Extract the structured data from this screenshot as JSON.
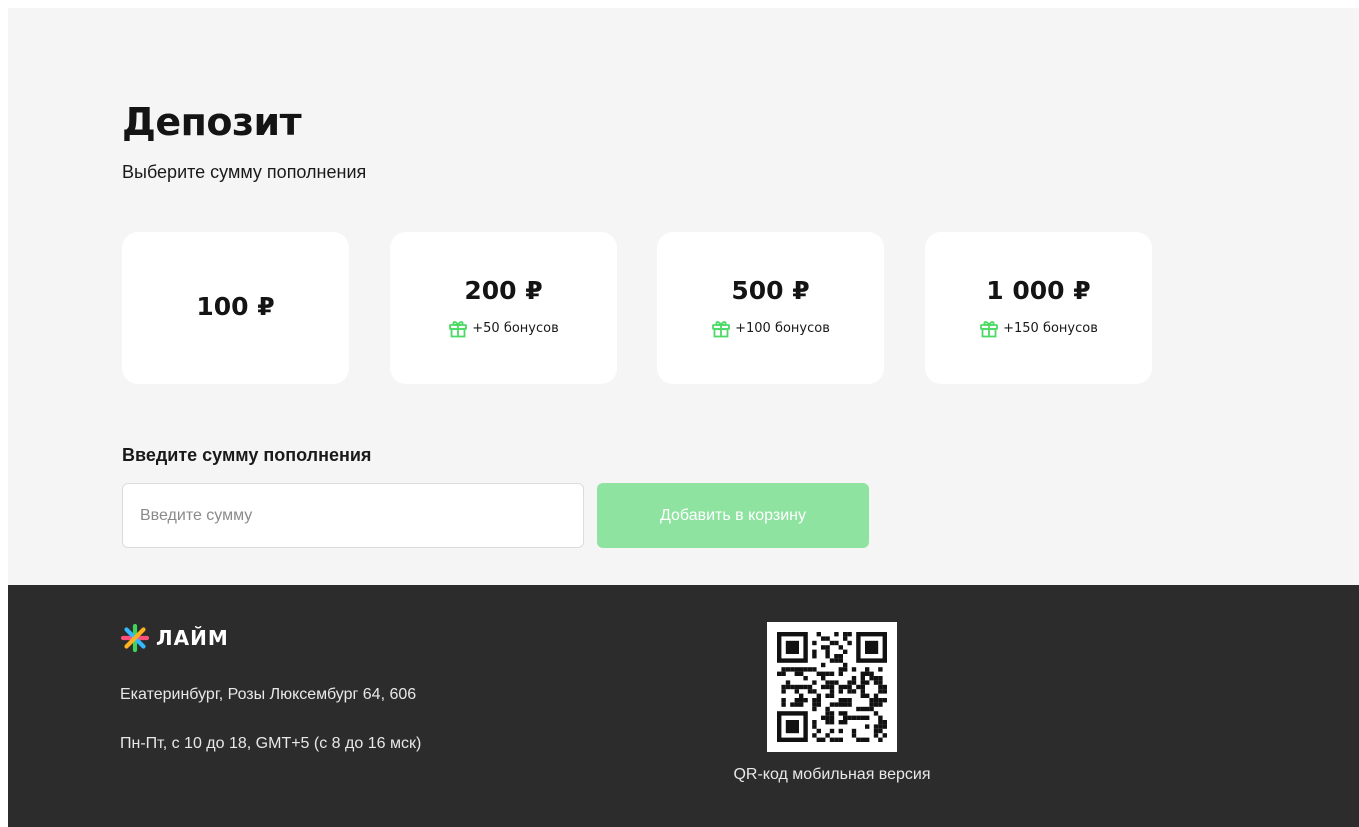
{
  "deposit": {
    "title": "Депозит",
    "subtitle": "Выберите сумму пополнения",
    "options": [
      {
        "price": "100 ₽"
      },
      {
        "price": "200 ₽",
        "bonus": "+50  бонусов"
      },
      {
        "price": "500 ₽",
        "bonus": "+100  бонусов"
      },
      {
        "price": "1 000 ₽",
        "bonus": "+150  бонусов"
      }
    ],
    "custom": {
      "label": "Введите сумму пополнения",
      "placeholder": "Введите сумму",
      "value": "",
      "button_label": "Добавить в корзину"
    },
    "colors": {
      "accent_green": "#8fe3a0",
      "gift_icon": "#4cd964"
    },
    "icons": {
      "bonus": "gift-icon"
    }
  },
  "footer": {
    "logo_text": "ЛАЙМ",
    "address": "Екатеринбург, Розы Люксембург 64, 606",
    "hours": "Пн-Пт, с 10 до 18, GMT+5 (с 8 до 16 мск)",
    "qr_caption": "QR-код мобильная версия",
    "background": "#2c2c2c"
  }
}
